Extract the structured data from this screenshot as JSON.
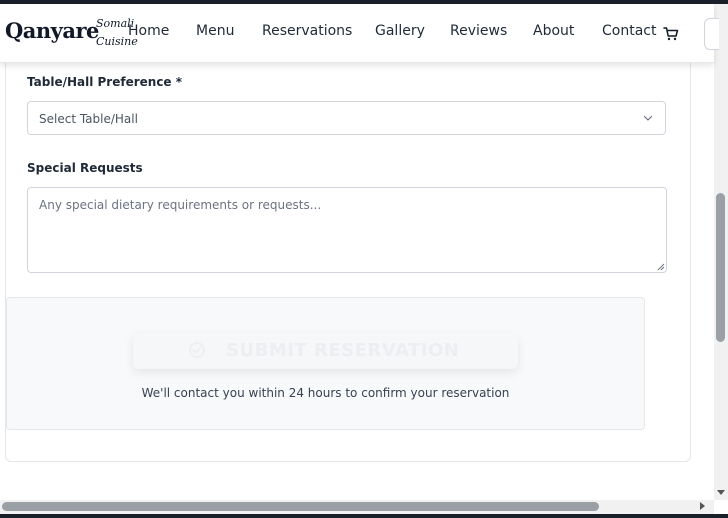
{
  "header": {
    "brand": "Qanyare",
    "brand_sub_line1": "Somali",
    "brand_sub_line2": "Cuisine",
    "nav": [
      "Home",
      "Menu",
      "Reservations",
      "Gallery",
      "Reviews",
      "About",
      "Contact"
    ],
    "cart_icon": "cart-icon"
  },
  "form": {
    "table_label": "Table/Hall Preference *",
    "table_placeholder": "Select Table/Hall",
    "special_label": "Special Requests",
    "special_placeholder": "Any special dietary requirements or requests..."
  },
  "submit": {
    "label": "SUBMIT RESERVATION",
    "icon": "check-circle-icon",
    "note": "We'll contact you within 24 hours to confirm your reservation"
  },
  "colors": {
    "text": "#1f2937",
    "border": "#d1d5db",
    "panel": "#f8f9fb",
    "scrollbar": "#9aa0a6"
  }
}
